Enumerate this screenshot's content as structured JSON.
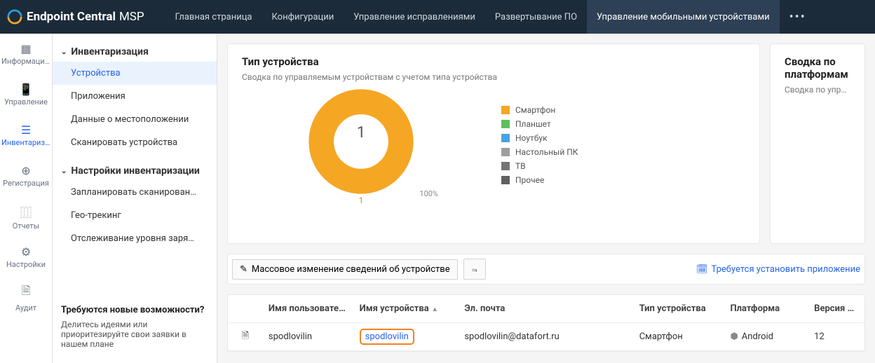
{
  "brand": {
    "name": "Endpoint Central",
    "suffix": "MSP"
  },
  "topnav": {
    "items": [
      "Главная страница",
      "Конфигурации",
      "Управление исправлениями",
      "Развертывание ПО",
      "Управление мобильными устройствами"
    ],
    "active_index": 4
  },
  "rail": {
    "items": [
      "Информационная панель",
      "Управление",
      "Инвентаризация",
      "Регистрация",
      "Отчеты",
      "Настройки",
      "Аудит"
    ],
    "active_index": 2
  },
  "side": {
    "group1": "Инвентаризация",
    "group1_items": [
      "Устройства",
      "Приложения",
      "Данные о местоположении",
      "Сканировать устройства"
    ],
    "group1_active": 0,
    "group2": "Настройки инвентаризации",
    "group2_items": [
      "Запланировать сканирован…",
      "Гео-трекинг",
      "Отслеживание уровня заря…"
    ],
    "promo": {
      "h": "Требуются новые возможности?",
      "t": "Делитесь идеями или приоритезируйте свои заявки в нашем плане"
    }
  },
  "cards": {
    "c1": {
      "title": "Тип устройства",
      "sub": "Сводка по управляемым устройствам с учетом типа устройства"
    },
    "c2": {
      "title": "Сводка по платформам",
      "sub": "Сводка по управляемым устройствам с учетом платформы"
    }
  },
  "chart_data": {
    "type": "pie",
    "title": "Тип устройства",
    "categories": [
      "Смартфон",
      "Планшет",
      "Ноутбук",
      "Настольный ПК",
      "ТВ",
      "Прочее"
    ],
    "values": [
      1,
      0,
      0,
      0,
      0,
      0
    ],
    "colors": [
      "#f5a623",
      "#5fbf5f",
      "#4aa3df",
      "#9e9e9e",
      "#757575",
      "#616161"
    ],
    "total_label": "1",
    "percent_label": "100%",
    "slice_label": "1"
  },
  "legend": [
    {
      "c": "#f5a623",
      "t": "Смартфон"
    },
    {
      "c": "#5fbf5f",
      "t": "Планшет"
    },
    {
      "c": "#4aa3df",
      "t": "Ноутбук"
    },
    {
      "c": "#9e9e9e",
      "t": "Настольный ПК"
    },
    {
      "c": "#757575",
      "t": "ТВ"
    },
    {
      "c": "#616161",
      "t": "Прочее"
    }
  ],
  "toolbar": {
    "bulk_btn": "Массовое изменение сведений об устройстве",
    "link": "Требуется установить приложение"
  },
  "table": {
    "headers": {
      "user": "Имя пользователя",
      "device": "Имя устройства",
      "email": "Эл. почта",
      "type": "Тип устройства",
      "platform": "Платформа",
      "os": "Версия ОС"
    },
    "rows": [
      {
        "user": "spodlovilin",
        "device": "spodlovilin",
        "email": "spodlovilin@datafort.ru",
        "type": "Смартфон",
        "platform": "Android",
        "os": "12"
      }
    ]
  }
}
